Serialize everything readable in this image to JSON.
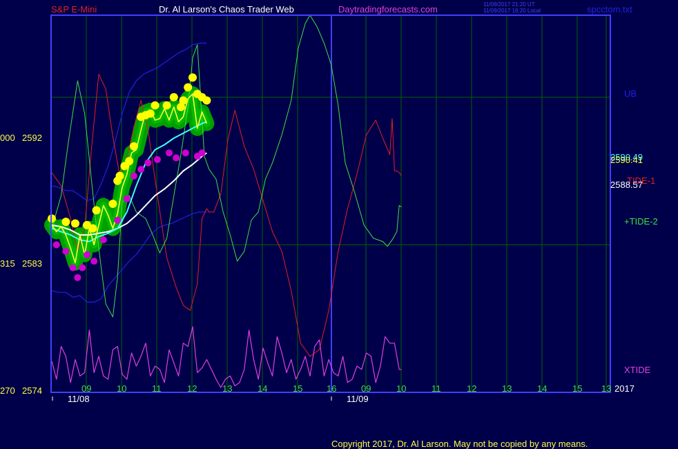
{
  "header": {
    "symbol": "S&P E-Mini",
    "title": "Dr. Al Larson's Chaos Trader Web",
    "site": "Daytradingforecasts.com",
    "utc_time": "11/09/2017 21:20 UT",
    "local_time": "11/09/2017 16:20 Local",
    "file": "spcctom.txt"
  },
  "footer": {
    "copyright": "Copyright 2017, Dr. Al Larson. May not be copied by any means."
  },
  "colors": {
    "background": "#00004a",
    "grid": "#006400",
    "frame": "#4040ff",
    "band": "#2020e0",
    "tide1": "#e02020",
    "tide2": "#40e040",
    "xtide": "#e040e0",
    "price": "#ffff40",
    "ma_fast": "#40ffff",
    "ma_slow": "#ffffff",
    "glow": "#00a000",
    "dot_high": "#ffff00",
    "dot_low": "#d000d0"
  },
  "chart_data": {
    "type": "line",
    "title": "S&P E-Mini",
    "x_axis": {
      "hour_ticks": [
        "09",
        "10",
        "11",
        "12",
        "13",
        "14",
        "15",
        "16",
        "09",
        "10",
        "11",
        "12",
        "13",
        "14",
        "15",
        "13"
      ],
      "date_labels": [
        "11/08",
        "11/09"
      ],
      "year_label": "2017"
    },
    "y_axis": {
      "ylim": [
        2574,
        2597
      ],
      "ticks": [
        {
          "value": 2592,
          "label": "2592",
          "left": "000"
        },
        {
          "value": 2583,
          "label": "2583",
          "left": "315"
        },
        {
          "value": 2574,
          "label": "2574",
          "left": "270"
        }
      ]
    },
    "right_labels": {
      "ub": "UB",
      "value_a": "2590.49",
      "value_b": "2590.41",
      "tide1": "TIDE-1",
      "value_c": "2588.57",
      "tide2": "+TIDE-2",
      "xtide": "XTIDE"
    },
    "series": [
      {
        "name": "UB",
        "key": "ub",
        "x": [
          0,
          6,
          12,
          18,
          24,
          30,
          36,
          42,
          48,
          54,
          60,
          66,
          72,
          78,
          84,
          90,
          96,
          102,
          108,
          114,
          120,
          126,
          132,
          138,
          144,
          150,
          156,
          162
        ],
        "values": [
          2586.6,
          2586.5,
          2586.3,
          2586.3,
          2586.0,
          2585.7,
          2585.8,
          2586.7,
          2587.8,
          2589.3,
          2591.0,
          2592.3,
          2593.0,
          2593.4,
          2593.6,
          2593.8,
          2594.1,
          2594.4,
          2594.7,
          2594.9,
          2595.2,
          2595.3,
          2595.3,
          null,
          null,
          null,
          null,
          null
        ]
      },
      {
        "name": "LB",
        "key": "lb",
        "x": [
          0,
          6,
          12,
          18,
          24,
          30,
          36,
          42,
          48,
          54,
          60,
          66,
          72,
          78,
          84,
          90,
          96,
          102,
          108,
          114,
          120,
          126,
          132
        ],
        "values": [
          2580.2,
          2580.1,
          2580.1,
          2579.8,
          2579.9,
          2579.5,
          2579.5,
          2579.7,
          2580.5,
          2581.0,
          2581.5,
          2582.0,
          2582.4,
          2583.0,
          2583.6,
          2584.0,
          2584.2,
          2584.3,
          2584.5,
          2584.7,
          2584.9,
          2585.0,
          2585.0
        ]
      },
      {
        "name": "TIDE-1",
        "key": "tide1",
        "x": [
          0,
          8,
          16,
          22,
          28,
          34,
          40,
          46,
          52,
          58,
          64,
          70,
          76,
          82,
          90,
          98,
          106,
          112,
          118,
          124,
          128,
          132,
          134,
          138,
          144,
          150,
          156,
          164,
          172,
          180,
          188,
          196,
          204,
          212,
          220,
          228,
          236,
          244,
          252,
          260,
          268,
          276,
          282,
          288,
          290,
          292,
          294,
          296,
          298
        ],
        "values": [
          2587.4,
          2586.6,
          2584.6,
          2582.6,
          2584.0,
          2589.0,
          2593.4,
          2592.5,
          2589.6,
          2587.2,
          2588.2,
          2590.2,
          2591.8,
          2590.0,
          2586.0,
          2582.2,
          2580.4,
          2579.3,
          2579.0,
          2580.6,
          2584.6,
          2585.2,
          2585.0,
          2585.0,
          2586.1,
          2589.4,
          2591.2,
          2589.0,
          2587.6,
          2585.7,
          2583.8,
          2582.6,
          2580.2,
          2577.0,
          2576.2,
          2576.6,
          2579.0,
          2582.6,
          2585.2,
          2587.3,
          2589.7,
          2590.6,
          2589.5,
          2588.5,
          2590.7,
          2587.5,
          2587.5,
          2587.4,
          2587.2
        ]
      },
      {
        "name": "+TIDE-2",
        "key": "tide2",
        "x": [
          0,
          8,
          14,
          22,
          28,
          34,
          40,
          46,
          52,
          56,
          60,
          66,
          72,
          80,
          86,
          92,
          98,
          104,
          110,
          116,
          120,
          124,
          130,
          134,
          140,
          146,
          152,
          158,
          164,
          170,
          176,
          182,
          188,
          196,
          204,
          210,
          216,
          220,
          226,
          232,
          238,
          244,
          250,
          258,
          266,
          274,
          282,
          286,
          290,
          294,
          296,
          298
        ],
        "values": [
          2584.0,
          2586.0,
          2589.2,
          2593.0,
          2591.0,
          2586.8,
          2582.8,
          2579.4,
          2578.6,
          2581.0,
          2585.6,
          2586.0,
          2585.0,
          2584.6,
          2583.6,
          2582.5,
          2583.4,
          2586.0,
          2588.5,
          2591.4,
          2594.4,
          2595.2,
          2588.4,
          2587.6,
          2587.0,
          2585.0,
          2583.6,
          2582.0,
          2582.6,
          2584.5,
          2585.0,
          2587.0,
          2588.0,
          2589.7,
          2591.8,
          2595.0,
          2596.5,
          2597.0,
          2596.3,
          2595.3,
          2594.0,
          2591.5,
          2588.0,
          2586.2,
          2584.2,
          2583.4,
          2583.2,
          2582.9,
          2583.3,
          2583.8,
          2585.4,
          2585.3
        ]
      },
      {
        "name": "XTIDE",
        "key": "xtide",
        "x": [
          0,
          4,
          8,
          12,
          16,
          20,
          24,
          28,
          32,
          36,
          40,
          44,
          48,
          52,
          56,
          60,
          64,
          68,
          72,
          76,
          80,
          84,
          88,
          92,
          96,
          100,
          104,
          108,
          112,
          116,
          120,
          124,
          128,
          132,
          136,
          140,
          144,
          148,
          152,
          156,
          160,
          164,
          168,
          172,
          176,
          180,
          184,
          188,
          192,
          196,
          200,
          204,
          208,
          212,
          216,
          220,
          224,
          228,
          232,
          236,
          240,
          244,
          248,
          252,
          256,
          260,
          264,
          268,
          272,
          276,
          280,
          284,
          288,
          292,
          296,
          298
        ],
        "values": [
          2575.9,
          2574.8,
          2576.8,
          2576.2,
          2574.6,
          2576.0,
          2575.0,
          2575.2,
          2577.8,
          2575.2,
          2576.2,
          2575.0,
          2574.8,
          2576.6,
          2576.8,
          2575.1,
          2574.8,
          2576.4,
          2575.6,
          2576.2,
          2577.0,
          2575.0,
          2575.6,
          2575.4,
          2574.6,
          2576.6,
          2575.8,
          2575.0,
          2577.0,
          2576.8,
          2578.0,
          2575.2,
          2575.5,
          2576.0,
          2575.4,
          2574.8,
          2574.3,
          2574.8,
          2575.0,
          2574.4,
          2574.6,
          2575.4,
          2577.8,
          2576.0,
          2574.8,
          2576.7,
          2575.8,
          2575.0,
          2577.4,
          2576.4,
          2575.2,
          2576.0,
          2574.8,
          2575.4,
          2576.2,
          2575.0,
          2576.8,
          2577.2,
          2575.0,
          2576.0,
          2575.2,
          2575.0,
          2576.2,
          2574.6,
          2574.8,
          2575.6,
          2575.4,
          2576.4,
          2576.2,
          2574.6,
          2575.6,
          2577.4,
          2577.0,
          2577.0,
          2575.4,
          2575.4
        ]
      },
      {
        "name": "Price",
        "key": "price",
        "x": [
          0,
          4,
          8,
          12,
          16,
          20,
          24,
          28,
          32,
          36,
          40,
          44,
          48,
          52,
          56,
          60,
          64,
          68,
          72,
          76,
          80,
          84,
          88,
          92,
          96,
          100,
          104,
          108,
          112,
          116,
          120,
          124,
          128,
          132
        ],
        "values": [
          2584.2,
          2583.8,
          2584.1,
          2583.6,
          2582.8,
          2581.9,
          2583.6,
          2582.4,
          2584.0,
          2583.0,
          2584.2,
          2585.4,
          2584.8,
          2584.0,
          2584.9,
          2586.5,
          2587.3,
          2588.6,
          2588.8,
          2590.0,
          2591.1,
          2591.2,
          2590.6,
          2590.7,
          2591.3,
          2590.6,
          2591.4,
          2590.5,
          2590.8,
          2591.9,
          2592.2,
          2590.1,
          2591.1,
          2590.4
        ]
      },
      {
        "name": "Fast MA",
        "key": "ma_fast",
        "x": [
          0,
          8,
          16,
          24,
          32,
          40,
          48,
          56,
          64,
          72,
          80,
          88,
          96,
          104,
          112,
          120,
          128,
          132
        ],
        "values": [
          2584.0,
          2583.8,
          2583.6,
          2583.3,
          2583.2,
          2583.5,
          2583.7,
          2584.0,
          2585.0,
          2586.6,
          2588.0,
          2588.8,
          2589.1,
          2589.5,
          2589.8,
          2590.1,
          2590.4,
          2590.5
        ]
      },
      {
        "name": "Slow MA",
        "key": "ma_slow",
        "x": [
          0,
          8,
          16,
          24,
          32,
          40,
          48,
          56,
          64,
          72,
          80,
          88,
          96,
          104,
          112,
          120,
          128,
          132
        ],
        "values": [
          2584.2,
          2584.1,
          2583.9,
          2583.6,
          2583.6,
          2583.7,
          2583.8,
          2584.0,
          2584.3,
          2584.8,
          2585.4,
          2586.0,
          2586.4,
          2586.9,
          2587.5,
          2587.9,
          2588.4,
          2588.6
        ]
      }
    ],
    "markers_high": {
      "x": [
        0,
        12,
        20,
        30,
        35,
        38,
        52,
        56,
        58,
        62,
        66,
        70,
        76,
        80,
        84,
        88,
        98,
        104,
        110,
        112,
        116,
        120,
        124,
        128,
        132
      ],
      "values": [
        2584.6,
        2584.4,
        2584.3,
        2584.2,
        2584.0,
        2585.1,
        2585.5,
        2586.9,
        2587.2,
        2587.8,
        2588.1,
        2589.0,
        2590.8,
        2590.9,
        2591.0,
        2591.5,
        2591.5,
        2592.0,
        2591.4,
        2591.8,
        2592.6,
        2593.2,
        2592.2,
        2592.0,
        2591.8
      ]
    },
    "markers_low": {
      "x": [
        4,
        12,
        18,
        22,
        26,
        30,
        36,
        44,
        56,
        64,
        70,
        76,
        82,
        90,
        100,
        106,
        114,
        124,
        128
      ],
      "values": [
        2583.0,
        2582.6,
        2581.6,
        2581.0,
        2581.6,
        2582.4,
        2582.0,
        2583.3,
        2584.5,
        2585.8,
        2587.2,
        2587.6,
        2588.0,
        2588.2,
        2588.6,
        2588.3,
        2588.6,
        2588.4,
        2588.6
      ]
    }
  }
}
